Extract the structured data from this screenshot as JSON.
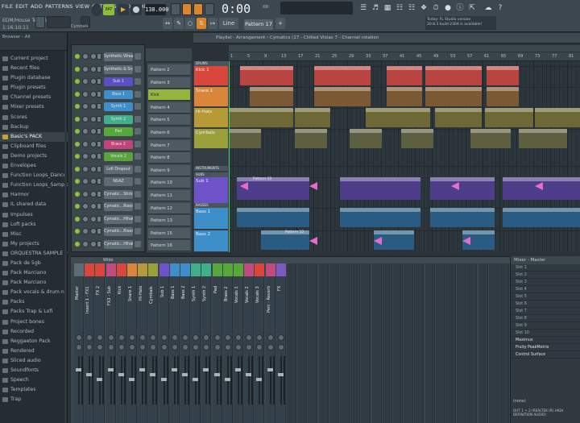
{
  "menu": [
    "FILE",
    "EDIT",
    "ADD",
    "PATTERNS",
    "VIEW",
    "OPTIONS",
    "TOOLS",
    "HELP"
  ],
  "project": {
    "title": "EDM/House Template",
    "time": "1:16:10:11"
  },
  "transport": {
    "tempo": "138.000",
    "clock": "0:00",
    "clock_unit": ":00",
    "pattern": "Pattern 17"
  },
  "news": {
    "line1": "Today: FL Studio version",
    "line2": "20.8.3 build 2304 is available!"
  },
  "browser": {
    "header": "Browser - All",
    "items": [
      {
        "label": "Current project",
        "hl": false
      },
      {
        "label": "Recent files",
        "hl": false
      },
      {
        "label": "Plugin database",
        "hl": false
      },
      {
        "label": "Plugin presets",
        "hl": false
      },
      {
        "label": "Channel presets",
        "hl": false
      },
      {
        "label": "Mixer presets",
        "hl": false
      },
      {
        "label": "Scores",
        "hl": false
      },
      {
        "label": "Backup",
        "hl": false
      },
      {
        "label": "Basic's PACK",
        "hl": true
      },
      {
        "label": "Clipboard files",
        "hl": false
      },
      {
        "label": "Demo projects",
        "hl": false
      },
      {
        "label": "Envelopes",
        "hl": false
      },
      {
        "label": "Function Loops_Dance Jan 2022",
        "hl": false
      },
      {
        "label": "Function Loops_Sampler 2021",
        "hl": false
      },
      {
        "label": "Harmor",
        "hl": false
      },
      {
        "label": "IL shared data",
        "hl": false
      },
      {
        "label": "Impulses",
        "hl": false
      },
      {
        "label": "Loft packs",
        "hl": false
      },
      {
        "label": "Misc",
        "hl": false
      },
      {
        "label": "My projects",
        "hl": false
      },
      {
        "label": "ORQUESTRA SAMPLE + MIDI PACK",
        "hl": false
      },
      {
        "label": "Pack de 5gb",
        "hl": false
      },
      {
        "label": "Pack Marciano",
        "hl": false
      },
      {
        "label": "Pack Marciano",
        "hl": false
      },
      {
        "label": "Pack vocals & drum n' bass",
        "hl": false
      },
      {
        "label": "Packs",
        "hl": false
      },
      {
        "label": "Packs Trap & Lofi",
        "hl": false
      },
      {
        "label": "Project bones",
        "hl": false
      },
      {
        "label": "Recorded",
        "hl": false
      },
      {
        "label": "Reggaeton Pack",
        "hl": false
      },
      {
        "label": "Rendered",
        "hl": false
      },
      {
        "label": "Sliced audio",
        "hl": false
      },
      {
        "label": "Soundfonts",
        "hl": false
      },
      {
        "label": "Speech",
        "hl": false
      },
      {
        "label": "Templates",
        "hl": false
      },
      {
        "label": "Trap",
        "hl": false
      }
    ]
  },
  "rack": {
    "channels": [
      {
        "name": "Synthetic Wreak 1",
        "color": "#5f6b73"
      },
      {
        "name": "Synthetic & Snare",
        "color": "#5f6b73"
      },
      {
        "name": "Sub 1",
        "color": "#5b4fc4"
      },
      {
        "name": "Bass 1",
        "color": "#3e8ec9"
      },
      {
        "name": "Synth 1",
        "color": "#3e8ec9"
      },
      {
        "name": "Synth 2",
        "color": "#3fb08b"
      },
      {
        "name": "Pad",
        "color": "#56a83a"
      },
      {
        "name": "Brass 2",
        "color": "#c2457a"
      },
      {
        "name": "Vocals 2",
        "color": "#5aa23a"
      },
      {
        "name": "Lofi Dropout",
        "color": "#5f6b73"
      },
      {
        "name": "NSAZ",
        "color": "#5f6b73"
      },
      {
        "name": "Cymatic...Stick 6",
        "color": "#5f6b73"
      },
      {
        "name": "Cymatic...Riser 6",
        "color": "#5f6b73"
      },
      {
        "name": "Cymatic...Hihat 7",
        "color": "#5f6b73"
      },
      {
        "name": "Cymatic...Riser 2",
        "color": "#5f6b73"
      },
      {
        "name": "Cymatic...Hihat 18",
        "color": "#5f6b73"
      }
    ]
  },
  "patterns": [
    {
      "label": "Pattern 2",
      "sel": false
    },
    {
      "label": "Pattern 3",
      "sel": false
    },
    {
      "label": "Kick",
      "sel": true
    },
    {
      "label": "Pattern 4",
      "sel": false
    },
    {
      "label": "Pattern 5",
      "sel": false
    },
    {
      "label": "Pattern 6",
      "sel": false
    },
    {
      "label": "Pattern 7",
      "sel": false
    },
    {
      "label": "Pattern 8",
      "sel": false
    },
    {
      "label": "Pattern 9",
      "sel": false
    },
    {
      "label": "Pattern 10",
      "sel": false
    },
    {
      "label": "Pattern 11",
      "sel": false
    },
    {
      "label": "Pattern 12",
      "sel": false
    },
    {
      "label": "Pattern 13",
      "sel": false
    },
    {
      "label": "Pattern 15",
      "sel": false
    },
    {
      "label": "Pattern 16",
      "sel": false
    }
  ],
  "playlist": {
    "title": "Playlist - Arrangement › Cymatics (17 - Chilled Violas 7 - Channel rotation",
    "ruler": [
      "1",
      "5",
      "9",
      "13",
      "17",
      "21",
      "25",
      "29",
      "33",
      "37",
      "41",
      "45",
      "49",
      "53",
      "57",
      "61",
      "65",
      "69",
      "73",
      "77",
      "81"
    ],
    "tracks": [
      {
        "label": "Kick 1",
        "color": "#d9473c"
      },
      {
        "label": "Snare 1",
        "color": "#d9863b"
      },
      {
        "label": "Hi-Hats",
        "color": "#b79a35"
      },
      {
        "label": "Cymbals",
        "color": "#9aa13a"
      },
      {
        "label": "Sub 1",
        "color": "#6d53c7"
      },
      {
        "label": "Bass 1",
        "color": "#3e8ec9"
      },
      {
        "label": "Bass 2",
        "color": "#3e8ec9"
      }
    ],
    "groups": [
      {
        "label": "DRUMS"
      },
      {
        "label": "INSTRUMENTS"
      },
      {
        "label": "SUBS"
      },
      {
        "label": "BASSES"
      }
    ],
    "clip_labels": [
      "Pattern 10",
      "Pattern 12"
    ]
  },
  "mixer": {
    "header": "Wide",
    "strips": [
      {
        "name": "Master",
        "color": "#5f6b73"
      },
      {
        "name": "Insert 1 - FX1",
        "color": "#d9473c"
      },
      {
        "name": "FX 2",
        "color": "#d9473c"
      },
      {
        "name": "FX3 - Sub",
        "color": "#c24a7c"
      },
      {
        "name": "Kick",
        "color": "#d9473c"
      },
      {
        "name": "Snare 1",
        "color": "#d9863b"
      },
      {
        "name": "Hi-Hats",
        "color": "#b79a35"
      },
      {
        "name": "Cymbals",
        "color": "#9aa13a"
      },
      {
        "name": "Sub 1",
        "color": "#6d53c7"
      },
      {
        "name": "Bass 1",
        "color": "#3e8ec9"
      },
      {
        "name": "Bass 2",
        "color": "#3e8ec9"
      },
      {
        "name": "Synth 1",
        "color": "#3fb08b"
      },
      {
        "name": "Synth 2",
        "color": "#3fb08b"
      },
      {
        "name": "Pad",
        "color": "#56a83a"
      },
      {
        "name": "Brass 2",
        "color": "#56a83a"
      },
      {
        "name": "Vocals 1",
        "color": "#56a83a"
      },
      {
        "name": "Vocals 2",
        "color": "#c24a7c"
      },
      {
        "name": "Vocals 3",
        "color": "#d9473c"
      },
      {
        "name": "Perc - Reverb",
        "color": "#c24a7c"
      },
      {
        "name": "FX",
        "color": "#7b5abf"
      }
    ],
    "master_panel": {
      "title": "Mixer - Master",
      "slots": [
        "Slot 1",
        "Slot 2",
        "Slot 3",
        "Slot 4",
        "Slot 5",
        "Slot 6",
        "Slot 7",
        "Slot 8",
        "Slot 9",
        "Slot 10",
        "Maximus",
        "Fruity PeakMetrix",
        "Control Surface"
      ],
      "bottom_label": "(none)",
      "output": "OUT 1 + 2 (REALTEK (R) HIGH DEFINITION AUDIO)"
    }
  }
}
